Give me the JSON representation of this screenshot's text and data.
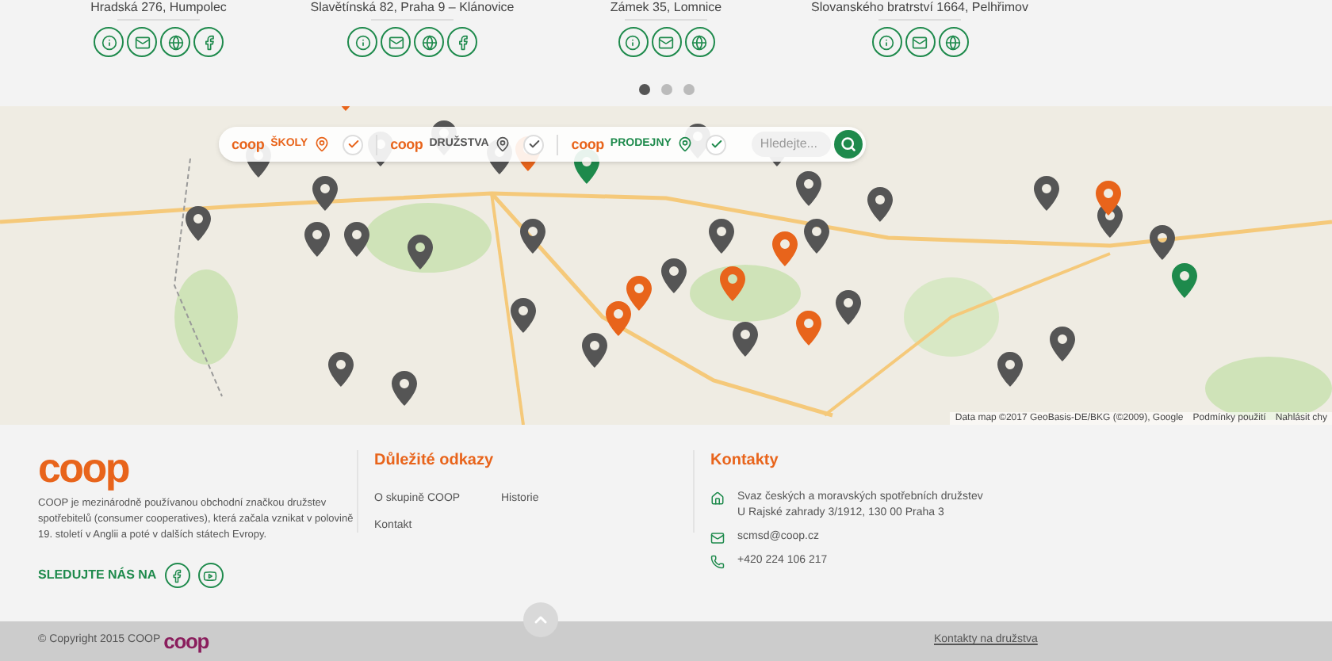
{
  "stores": [
    {
      "address": "Hradská 276, Humpolec",
      "icons": [
        {
          "kind": "info"
        },
        {
          "kind": "email"
        },
        {
          "kind": "web"
        },
        {
          "kind": "facebook"
        }
      ]
    },
    {
      "address": "Slavětínská 82, Praha 9 – Klánovice",
      "icons": [
        {
          "kind": "info"
        },
        {
          "kind": "email"
        },
        {
          "kind": "web"
        },
        {
          "kind": "facebook"
        }
      ]
    },
    {
      "address": "Zámek 35, Lomnice",
      "icons": [
        {
          "kind": "info"
        },
        {
          "kind": "email"
        },
        {
          "kind": "web"
        }
      ]
    },
    {
      "address": "Slovanského bratrství 1664, Pelhřimov",
      "icons": [
        {
          "kind": "info"
        },
        {
          "kind": "email"
        },
        {
          "kind": "web"
        }
      ]
    }
  ],
  "carousel_dots": [
    {
      "selected": true
    },
    {
      "selected": false
    },
    {
      "selected": false
    }
  ],
  "map": {
    "filters": [
      {
        "logo": "coop",
        "label": "ŠKOLY",
        "color": "#e8641b",
        "checked": true
      },
      {
        "logo": "coop",
        "label": "DRUŽSTVA",
        "color": "#555555",
        "checked": true
      },
      {
        "logo": "coop",
        "label": "PRODEJNY",
        "color": "#1e8a4c",
        "checked": true
      }
    ],
    "search": {
      "placeholder": "Hledejte..."
    },
    "attribution": [
      "Data map ©2017 GeoBasis-DE/BKG (©2009), Google",
      "Podmínky použití",
      "Nahlásit chy"
    ]
  },
  "footer": {
    "logo": "coop",
    "about": "COOP je mezinárodně používanou obchodní značkou družstev spotřebitelů (consumer cooperatives), která začala vznikat v polovině 19. století v Anglii a poté v dalších státech Evropy.",
    "follow_label": "SLEDUJTE NÁS NA",
    "social": [
      {
        "kind": "facebook"
      },
      {
        "kind": "youtube"
      }
    ],
    "links_title": "Důležité odkazy",
    "links": [
      "O skupině COOP",
      "Historie",
      "Kontakt"
    ],
    "contacts_title": "Kontakty",
    "contacts": [
      {
        "kind": "address",
        "lines": [
          "Svaz českých a moravských spotřebních družstev",
          "U Rajské zahrady 3/1912, 130 00 Praha 3"
        ]
      },
      {
        "kind": "email",
        "lines": [
          "scmsd@coop.cz"
        ]
      },
      {
        "kind": "phone",
        "lines": [
          "+420 224 106 217"
        ]
      }
    ]
  },
  "bottom_bar": {
    "copyright": "© Copyright 2015 COOP",
    "logo": "coop",
    "link": "Kontakty na družstva"
  }
}
